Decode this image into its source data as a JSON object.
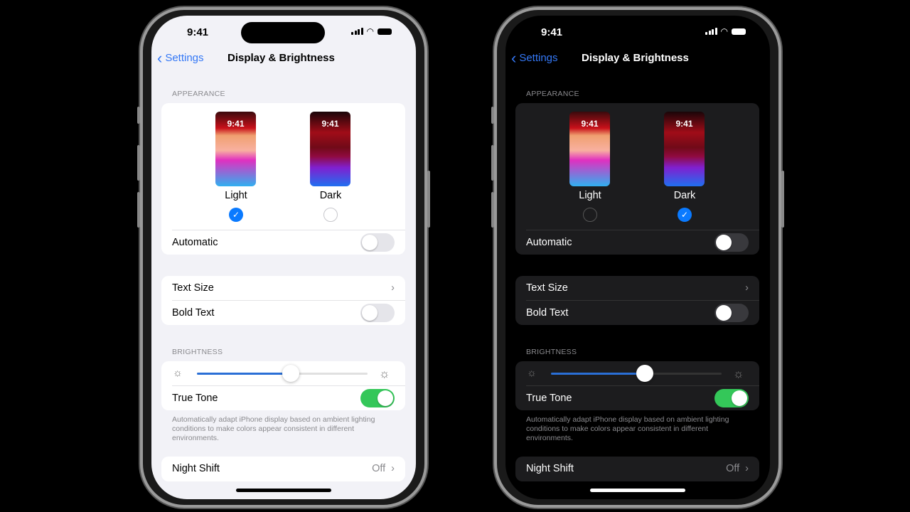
{
  "status": {
    "time": "9:41"
  },
  "nav": {
    "back_label": "Settings",
    "title": "Display & Brightness"
  },
  "appearance": {
    "section_label": "APPEARANCE",
    "preview_time": "9:41",
    "options": [
      {
        "label": "Light"
      },
      {
        "label": "Dark"
      }
    ],
    "automatic_label": "Automatic"
  },
  "text": {
    "text_size_label": "Text Size",
    "bold_text_label": "Bold Text"
  },
  "brightness": {
    "section_label": "BRIGHTNESS",
    "true_tone_label": "True Tone",
    "footer": "Automatically adapt iPhone display based on ambient lighting conditions to make colors appear consistent in different environments."
  },
  "night_shift": {
    "label": "Night Shift",
    "value": "Off"
  },
  "phones": [
    {
      "theme": "light",
      "selected_appearance": "Light",
      "automatic": false,
      "bold_text": false,
      "true_tone": true,
      "brightness_percent": 55
    },
    {
      "theme": "dark",
      "selected_appearance": "Dark",
      "automatic": false,
      "bold_text": false,
      "true_tone": true,
      "brightness_percent": 55
    }
  ],
  "colors": {
    "accent": "#3478f6",
    "toggle_on": "#34c759",
    "checkmark": "#0a7aff"
  }
}
